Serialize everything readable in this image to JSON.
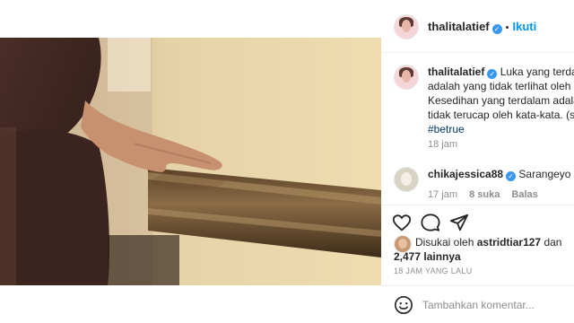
{
  "post": {
    "username": "thalitalatief",
    "follow_label": "Ikuti",
    "dot": "•",
    "verified_symbol": "✓"
  },
  "caption": {
    "username": "thalitalatief",
    "lines": [
      "Luka yang terdalam",
      "adalah yang tidak terlihat oleh m",
      "Kesedihan yang terdalam adalah",
      "tidak terucap oleh kata-kata. (se"
    ],
    "hashtag": "#betrue",
    "time": "18 jam"
  },
  "comment": {
    "username": "chikajessica88",
    "text": "Sarangeyo",
    "emoji": "😘",
    "time": "17 jam",
    "likes": "8 suka",
    "reply": "Balas"
  },
  "likes": {
    "prefix": "Disukai oleh",
    "user": "astridtiar127",
    "and": "dan",
    "count": "2,477 lainnya"
  },
  "timestamp": "18 JAM YANG LALU",
  "add_comment_placeholder": "Tambahkan komentar...",
  "colors": {
    "accent": "#0095f6",
    "verified": "#3897f0",
    "muted": "#8e8e8e"
  },
  "icons": [
    "heart-icon",
    "comment-icon",
    "share-icon",
    "emoji-icon"
  ]
}
